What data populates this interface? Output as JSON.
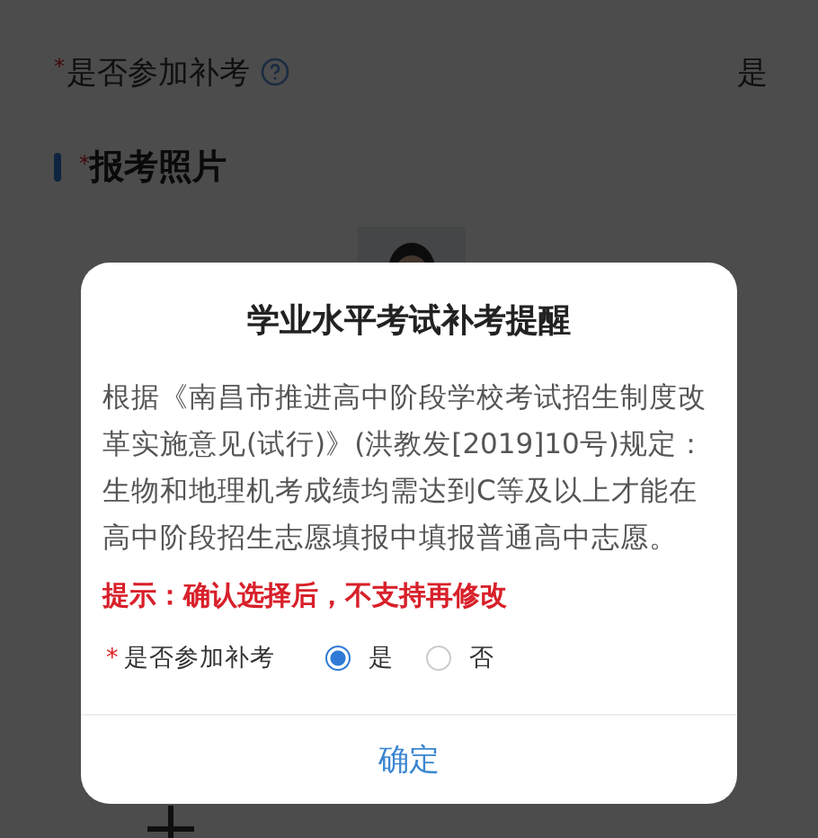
{
  "page": {
    "field": {
      "mark": "*",
      "label": "是否参加补考",
      "value": "是"
    },
    "section": {
      "mark": "*",
      "title": "报考照片"
    }
  },
  "dialog": {
    "title": "学业水平考试补考提醒",
    "body": "根据《南昌市推进高中阶段学校考试招生制度改革实施意见(试行)》(洪教发[2019]10号)规定：生物和地理机考成绩均需达到C等及以上才能在高中阶段招生志愿填报中填报普通高中志愿。",
    "warning": "提示：确认选择后，不支持再修改",
    "question": {
      "mark": "*",
      "label": "是否参加补考"
    },
    "options": [
      {
        "label": "是",
        "selected": true
      },
      {
        "label": "否",
        "selected": false
      }
    ],
    "button": "确定"
  }
}
